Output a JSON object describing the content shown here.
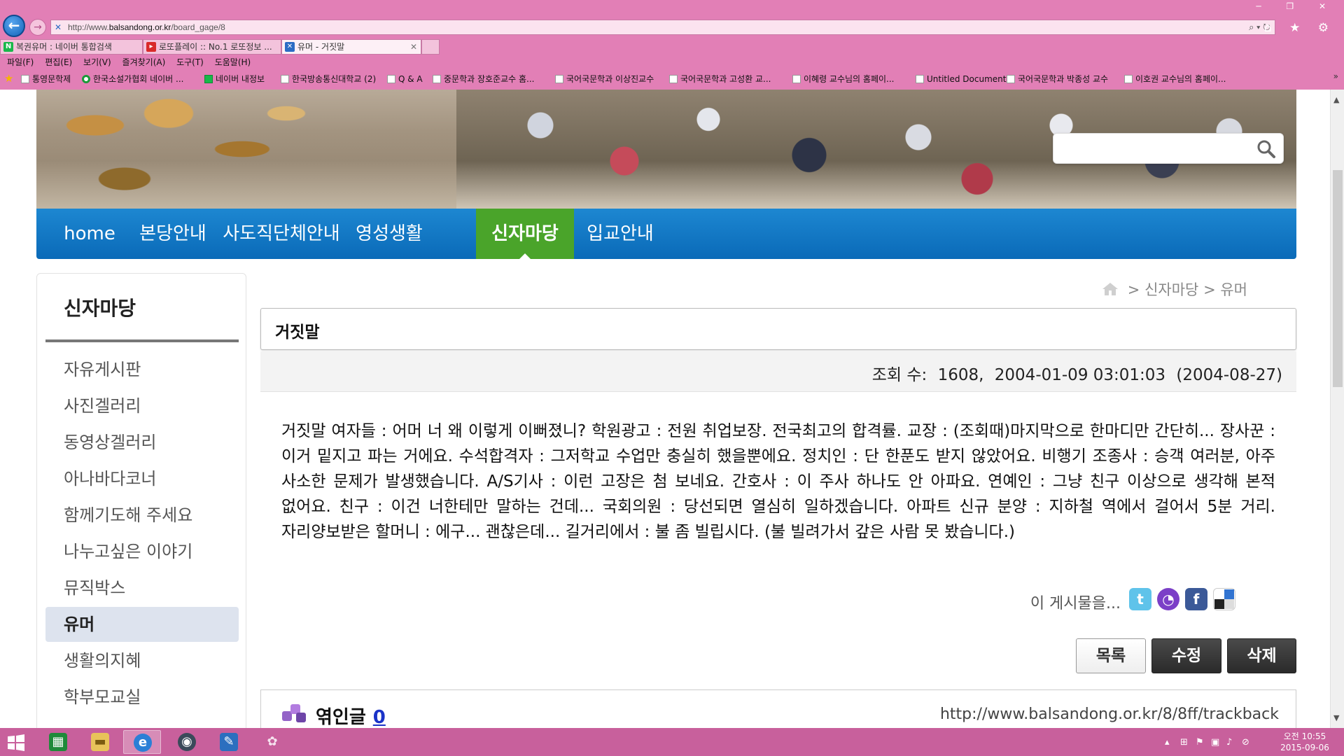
{
  "browser": {
    "address_url_prefix": "http://www.",
    "address_url_domain": "balsandong.or.kr",
    "address_url_path": "/board_gage/8",
    "tabs": [
      {
        "label": "복권유머 : 네이버 통합검색"
      },
      {
        "label": "로또플레이 :: No.1 로또정보 ..."
      },
      {
        "label": "유머 - 거짓말"
      }
    ],
    "menu": [
      "파일(F)",
      "편집(E)",
      "보기(V)",
      "즐겨찾기(A)",
      "도구(T)",
      "도움말(H)"
    ],
    "favorites": [
      "통영문학제",
      "한국소설가협회 네이버 ...",
      "네이버 내정보",
      "한국방송통신대학교 (2)",
      "Q & A",
      "중문학과 장호준교수 홈...",
      "국어국문학과 이상진교수",
      "국어국문학과 고성환 교...",
      "이혜령 교수님의 홈페이...",
      "Untitled Document",
      "국어국문학과 박종성 교수",
      "이호권 교수님의 홈페이..."
    ],
    "favorites_more": "»"
  },
  "site": {
    "nav": [
      "home",
      "본당안내",
      "사도직단체안내",
      "영성생활",
      "신자마당",
      "입교안내"
    ],
    "nav_active_index": 4,
    "search_value": "",
    "colors": {
      "nav_blue": "#0a6ab8",
      "nav_active_green": "#4aa42a"
    }
  },
  "sidebar": {
    "title": "신자마당",
    "items": [
      "자유게시판",
      "사진겔러리",
      "동영상겔러리",
      "아나바다코너",
      "함께기도해 주세요",
      "나누고싶은 이야기",
      "뮤직박스",
      "유머",
      "생활의지혜",
      "학부모교실"
    ],
    "active_index": 7
  },
  "breadcrumb": {
    "sep1": ">",
    "section": "신자마당",
    "sep2": ">",
    "page": "유머"
  },
  "post": {
    "title": "거짓말",
    "views_label": "조회 수:",
    "views": "1608,",
    "date": "2004-01-09 03:01:03",
    "updated": "(2004-08-27)",
    "body": "거짓말 여자들 : 어머 너 왜 이렇게 이뻐졌니? 학원광고 : 전원 취업보장. 전국최고의 합격률. 교장 : (조회때)마지막으로 한마디만 간단히... 장사꾼 : 이거 밑지고 파는 거에요. 수석합격자 : 그저학교 수업만 충실히 했을뿐에요. 정치인 : 단 한푼도 받지 않았어요. 비행기 조종사 : 승객 여러분, 아주 사소한 문제가 발생했습니다. A/S기사 : 이런 고장은 첨 보네요. 간호사 : 이 주사 하나도 안 아파요. 연예인 : 그냥 친구 이상으로 생각해 본적 없어요. 친구 : 이건 너한테만 말하는 건데... 국회의원 : 당선되면 열심히 일하겠습니다. 아파트 신규 분양 : 지하철 역에서 걸어서 5분 거리. 자리양보받은 할머니 : 에구... 괜찮은데... 길거리에서 : 불 좀 빌립시다. (불 빌려가서 갚은 사람 못 봤습니다.)",
    "share_label": "이 게시물을...",
    "buttons": {
      "list": "목록",
      "edit": "수정",
      "delete": "삭제"
    },
    "trackback_label": "엮인글",
    "trackback_count": "0",
    "trackback_url": "http://www.balsandong.or.kr/8/8ff/trackback"
  },
  "taskbar": {
    "clock_time": "오전 10:55",
    "clock_date": "2015-09-06"
  }
}
